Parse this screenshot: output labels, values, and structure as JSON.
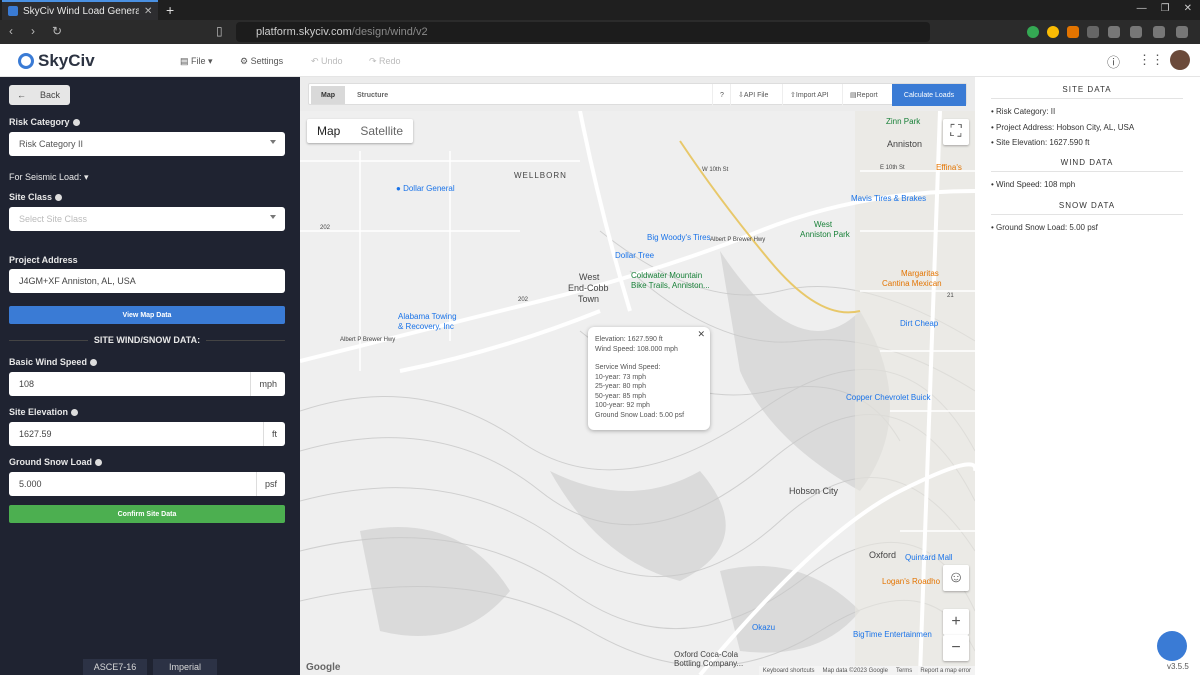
{
  "browser": {
    "tab_title": "SkyCiv Wind Load Genera",
    "url_host": "platform.skyciv.com",
    "url_path": "/design/wind/v2"
  },
  "app": {
    "logo_text": "SkyCiv",
    "menu": {
      "file": "File",
      "settings": "Settings",
      "undo": "Undo",
      "redo": "Redo"
    }
  },
  "sidebar": {
    "back": "Back",
    "risk_category_label": "Risk Category",
    "risk_category_value": "Risk Category II",
    "seismic_label": "For Seismic Load:",
    "site_class_label": "Site Class",
    "site_class_placeholder": "Select Site Class",
    "project_address_label": "Project Address",
    "project_address_value": "J4GM+XF Anniston, AL, USA",
    "view_map_button": "View Map Data",
    "section_title": "SITE WIND/SNOW DATA:",
    "wind_speed_label": "Basic Wind Speed",
    "wind_speed_value": "108",
    "wind_speed_unit": "mph",
    "elevation_label": "Site Elevation",
    "elevation_value": "1627.59",
    "elevation_unit": "ft",
    "snow_label": "Ground Snow Load",
    "snow_value": "5.000",
    "snow_unit": "psf",
    "confirm_button": "Confirm Site Data",
    "footer_code": "ASCE7-16",
    "footer_units": "Imperial"
  },
  "toolbar": {
    "tab_map": "Map",
    "tab_structure": "Structure",
    "help": "?",
    "api_file": "API File",
    "import_api": "Import API",
    "report": "Report",
    "calculate": "Calculate Loads"
  },
  "map": {
    "type_map": "Map",
    "type_satellite": "Satellite",
    "popup": {
      "line1": "Elevation: 1627.590 ft",
      "line2": "Wind Speed: 108.000 mph",
      "line3": "Service Wind Speed:",
      "line4": "10-year: 73 mph",
      "line5": "25-year: 80 mph",
      "line6": "50-year: 85 mph",
      "line7": "100-year: 92 mph",
      "line8": "Ground Snow Load: 5.00 psf"
    },
    "labels": {
      "anniston": "Anniston",
      "zinn_park": "Zinn Park",
      "wellborn": "WELLBORN",
      "west_end": "West",
      "west_end2": "End-Cobb",
      "west_end3": "Town",
      "hobson_city": "Hobson City",
      "oxford": "Oxford",
      "w10th": "W 10th St",
      "e10th": "E 10th St",
      "abp": "Albert P Brewer Hwy",
      "abp2": "Albert P Brewer Hwy",
      "r202a": "202",
      "r202b": "202",
      "r21": "21"
    },
    "pois": {
      "dollar_general": "Dollar General",
      "big_woodys": "Big Woody's Tires",
      "dollar_tree": "Dollar Tree",
      "coldwater": "Coldwater Mountain",
      "coldwater2": "Bike Trails, Anniston...",
      "mavis": "Mavis Tires & Brakes",
      "west_anniston": "West",
      "west_anniston2": "Anniston Park",
      "margaritas": "Margaritas",
      "margaritas2": "Cantina Mexican",
      "dirt_cheap": "Dirt Cheap",
      "alabama_towing": "Alabama Towing",
      "alabama_towing2": "& Recovery, Inc",
      "copper": "Copper Chevrolet Buick",
      "effinas": "Effina's",
      "quintard": "Quintard Mall",
      "logans": "Logan's Roadho",
      "bigtime": "BigTime Entertainmen",
      "okazu": "Okazu",
      "oxford_coke": "Oxford Coca-Cola",
      "oxford_coke2": "Bottling Company..."
    },
    "footer": {
      "google": "Google",
      "shortcuts": "Keyboard shortcuts",
      "mapdata": "Map data ©2023 Google",
      "terms": "Terms",
      "report": "Report a map error"
    }
  },
  "right_panel": {
    "site_data_title": "SITE DATA",
    "risk_category": "Risk Category: II",
    "project_address": "Project Address: Hobson City, AL, USA",
    "site_elevation": "Site Elevation: 1627.590 ft",
    "wind_data_title": "WIND DATA",
    "wind_speed": "Wind Speed: 108 mph",
    "snow_data_title": "SNOW DATA",
    "ground_snow": "Ground Snow Load: 5.00 psf"
  },
  "version": "v3.5.5",
  "colors": {
    "sidebar_bg": "#1f2331",
    "accent_blue": "#3a7bd5",
    "confirm_green": "#4caf50"
  }
}
